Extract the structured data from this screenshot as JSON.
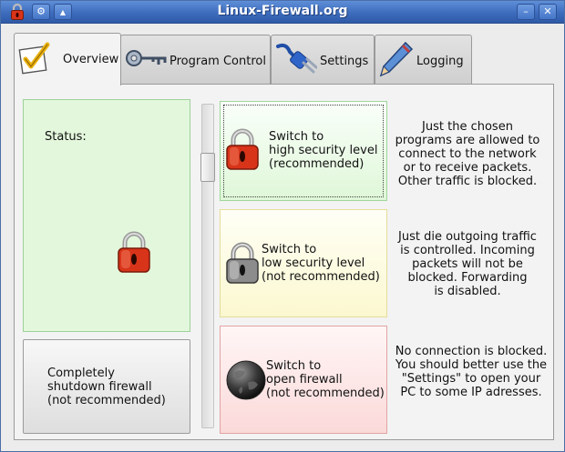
{
  "window": {
    "title": "Linux-Firewall.org",
    "buttons": {
      "menu": "⚙",
      "up": "▲",
      "minimize": "–",
      "close": "✕"
    }
  },
  "tabs": [
    {
      "label": "Overview",
      "icon": "checklist-icon",
      "active": true
    },
    {
      "label": "Program Control",
      "icon": "key-icon",
      "active": false
    },
    {
      "label": "Settings",
      "icon": "plug-icon",
      "active": false
    },
    {
      "label": "Logging",
      "icon": "pencil-icon",
      "active": false
    }
  ],
  "overview": {
    "status_label": "Status:",
    "status_icon": "red-padlock-icon",
    "shutdown": {
      "line1": "Completely",
      "line2": "shutdown firewall",
      "line3": "(not recommended)"
    },
    "levels": {
      "high": {
        "line1": "Switch to",
        "line2": "high security level",
        "line3": "(recommended)",
        "icon": "red-padlock-icon",
        "desc": [
          "Just the chosen",
          "programs are allowed to",
          "connect to the network",
          "or to receive packets.",
          "Other traffic is blocked."
        ]
      },
      "low": {
        "line1": "Switch to",
        "line2": "low security level",
        "line3": "(not recommended)",
        "icon": "grey-padlock-icon",
        "desc": [
          "Just die outgoing traffic",
          "is controlled. Incoming",
          "packets will not be",
          "blocked. Forwarding",
          "is disabled."
        ]
      },
      "open": {
        "line1": "Switch to",
        "line2": "open firewall",
        "line3": "(not recommended)",
        "icon": "dark-globe-icon",
        "desc": [
          "No connection is blocked.",
          "You should better use the",
          "\"Settings\" to open your",
          "PC to some IP adresses."
        ]
      }
    }
  },
  "colors": {
    "title_bar": "#3d6cbd",
    "high_bg": "#dff7d8",
    "low_bg": "#fbf8d0",
    "open_bg": "#fbd9d9",
    "lock_red": "#d8341a"
  }
}
